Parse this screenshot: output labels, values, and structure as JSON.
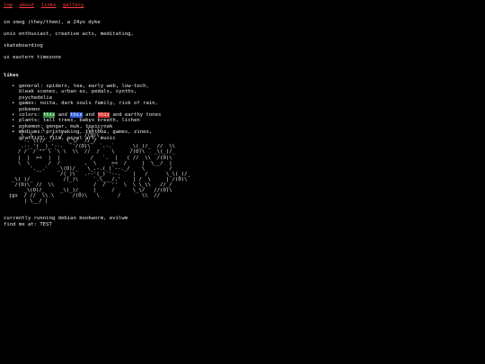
{
  "nav": {
    "links": [
      "top",
      "about",
      "links",
      "gallery"
    ]
  },
  "intro": {
    "line1": "im smog (they/them), a 24yo dyke",
    "line2": "unix enthusiast, creative acts, meditating,",
    "line3": "skateboarding",
    "line4": "us eastern timezone"
  },
  "likes": {
    "heading": "likes",
    "general": "general: spiders, tea, early web, low-tech, bleak scenes, urban ex, pedals, synths, psychedelia",
    "games": "games: noita, dark souls family, risk of rain, pokemon",
    "colors": {
      "prefix": "colors: ",
      "word1": "this",
      "and1": " and ",
      "word2": "this",
      "and2": " and ",
      "word3": "this",
      "suffix": " and earthy tones",
      "highlight_colors": [
        "#2b8a3e",
        "#2d5bd6",
        "#d83232"
      ]
    },
    "plants": "plants: tall trees, babys breath, lichen",
    "pokemon": "pokemon: gengar, muk, toxicroak",
    "mediums": "mediums: printmaking, tattoos, games, zines, graffiti, film, pixel art, music"
  },
  "ascii_art": "                            __\n      /      \\             _\\( )/_\n      \\  \\  ,,  /  /  _    /(O)\\\n      '-.`\\()/`.-'   \\_\\/  //_/\n      .--_'(  )_'--.  `'/(O)\\`  `.-.`     _\\(_)/_  //  \\\\\n     / /` /`\"\"`\\ `\\ \\  \\\\  //  /    \\     /(O)\\   _\\(_)/_\n     |  |  ><  |  |          /   `.  |   ( //  \\\\  /(O)\\\n     \\  \\      /  /        ,  \\     ><  /     |  \\__/  |\n         '.__.'   _\\(O)/_   \\_.-.( )`--._/    \\        /\n                   /(_)\\   .--'(_)`'--.    |   /      \\_\\(_)/_\n   _\\( )/_          /(_)\\     `.\\___/.'    | /  \\     | /(O)\\\n    /(O)\\  //  \\\\             /  /  ''  \\  \\ \\_\\\\   //_/\n       _\\(O)/_     _\\(_)/_    |     /      \\_\\/   //(O)\\\n  jgs  / //  \\\\ \\      /(O)\\   \\      /       \\\\  //\n       | \\__/ |\n",
  "footer": {
    "line1": "currently running debian bookworm, evilwm",
    "line2": "find me at: TEST"
  }
}
